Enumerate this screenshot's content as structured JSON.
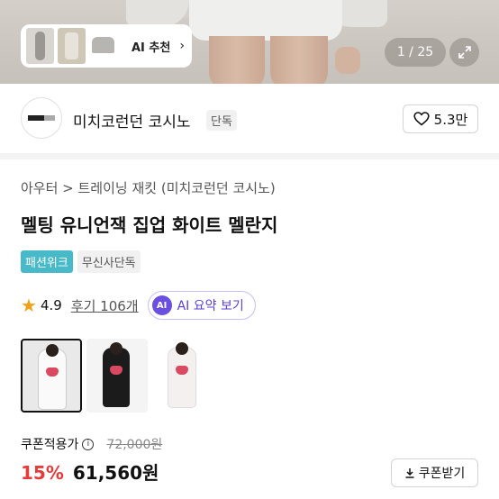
{
  "hero": {
    "ai_reco_label": "AI 추천",
    "counter": "1 / 25"
  },
  "brand": {
    "name": "미치코런던 코시노",
    "exclusive_tag": "단독",
    "likes": "5.3만"
  },
  "product": {
    "breadcrumb": "아우터 > 트레이닝 재킷 (미치코런던 코시노)",
    "title": "멜팅 유니언잭 집업 화이트 멜란지",
    "tags": [
      "패션위크",
      "무신사단독"
    ],
    "rating": "4.9",
    "reviews": "후기 106개",
    "ai_summary": "AI 요약 보기",
    "ai_badge": "AI"
  },
  "pricing": {
    "coupon_label": "쿠폰적용가",
    "original_price": "72,000원",
    "discount": "15%",
    "price": "61,560원",
    "coupon_button": "쿠폰받기"
  },
  "colors": {
    "discount": "#e63b3b",
    "tag_fashionweek": "#47b9c8",
    "ai_accent": "#6a4fe0"
  }
}
